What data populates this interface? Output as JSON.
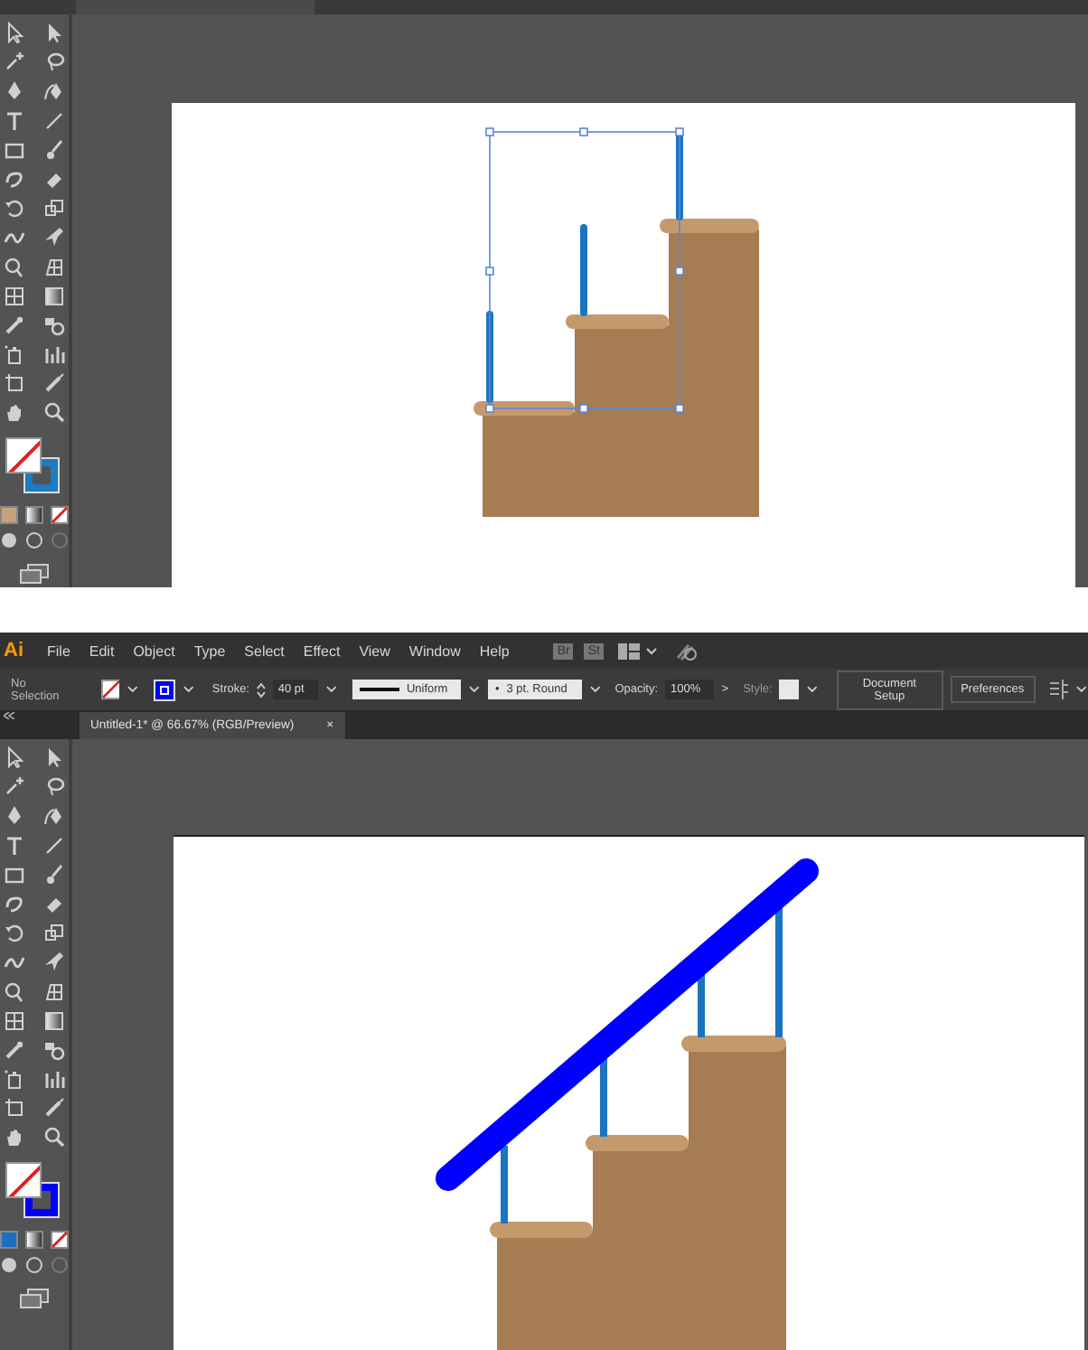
{
  "screenshots": [
    {
      "kind": "posts-selected"
    },
    {
      "kind": "railing-added",
      "menu_bar": {
        "logo": "Ai",
        "menus": [
          "File",
          "Edit",
          "Object",
          "Type",
          "Select",
          "Effect",
          "View",
          "Window",
          "Help"
        ],
        "bridge": "Br",
        "stock": "St"
      },
      "control_bar": {
        "selection": "No Selection",
        "stroke_label": "Stroke:",
        "stroke_weight": "40 pt",
        "profile": "Uniform",
        "brush_dot": "•",
        "brush": "3 pt. Round",
        "opacity_label": "Opacity:",
        "opacity": "100%",
        "opacity_arrow": ">",
        "style_label": "Style:",
        "buttons": [
          "Document Setup",
          "Preferences"
        ]
      },
      "document_tab": {
        "title": "Untitled-1* @ 66.67% (RGB/Preview)",
        "close": "×"
      }
    }
  ]
}
